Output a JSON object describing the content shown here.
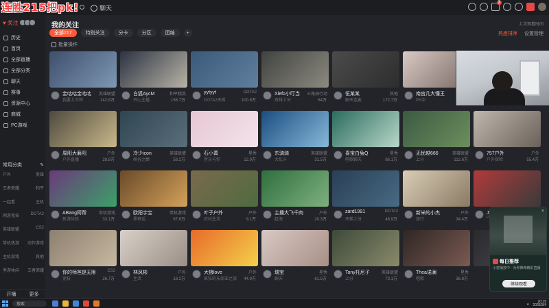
{
  "overlay_title": "连胜215把pk!",
  "topbar": {
    "chat_label": "聊天",
    "tool_icons": [
      "history-icon",
      "heart-icon",
      "message-icon",
      "notification-icon",
      "settings-icon",
      "gift-icon",
      "user-avatar"
    ],
    "badge_count": "7"
  },
  "sidebar": {
    "follow_label": "关注",
    "items": [
      {
        "label": "历史",
        "icon": "history-icon"
      },
      {
        "label": "首页",
        "icon": "home-icon"
      },
      {
        "label": "全部直播",
        "icon": "live-icon"
      },
      {
        "label": "全部分类",
        "icon": "category-icon"
      },
      {
        "label": "聊天",
        "icon": "chat-icon"
      },
      {
        "label": "赛事",
        "icon": "trophy-icon"
      },
      {
        "label": "资源中心",
        "icon": "resource-icon"
      },
      {
        "label": "商城",
        "icon": "shop-icon"
      },
      {
        "label": "PC游戏",
        "icon": "pc-game-icon"
      }
    ],
    "common_label": "常用分类",
    "sub_rows": [
      [
        "户外",
        "英雄"
      ],
      [
        "王者荣耀",
        "和平"
      ],
      [
        "一起看",
        "主机"
      ],
      [
        "网游竞技",
        "DOTA2"
      ],
      [
        "英雄联盟",
        "CS2"
      ],
      [
        "单机热游",
        "动作游戏"
      ],
      [
        "主机游戏",
        "其他"
      ],
      [
        "手游休闲",
        "王者荣耀"
      ]
    ],
    "bottom": [
      "开播",
      "更多"
    ]
  },
  "main": {
    "title": "我的关注",
    "hint": "上次观看时间",
    "filters": [
      "全部217",
      "特别关注",
      "分卡",
      "分区",
      "团编",
      "+"
    ],
    "right_actions": {
      "hot": "热度排序",
      "settings": "设置管理"
    },
    "batch_label": "批量操作"
  },
  "cards": [
    {
      "name": "金咕咕金咕咕",
      "cat": "英雄联盟",
      "sub": "我要上大师",
      "heat": "142.8万",
      "c1": "#3f4f6b",
      "c2": "#7d98b5"
    },
    {
      "name": "白狐AycM",
      "cat": "和平精英",
      "sub": "开心主播",
      "heat": "158.7万",
      "c1": "#2c3342",
      "c2": "#b9b3a6"
    },
    {
      "name": "yyfyyf",
      "cat": "DOTA2",
      "sub": "DOTA2天梯",
      "heat": "100.8万",
      "c1": "#3b5a7a",
      "c2": "#5f7f9f"
    },
    {
      "name": "Xlefo小叮当",
      "cat": "三角洲行动",
      "sub": "双排上分",
      "heat": "64万",
      "c1": "#40433f",
      "c2": "#8c8a80"
    },
    {
      "name": "伍某某",
      "cat": "其他",
      "sub": "聊天连麦",
      "heat": "172.7万",
      "c1": "#4b4b4b",
      "c2": "#2d2d2d"
    },
    {
      "name": "南宫几大懂王",
      "cat": "户外",
      "sub": "PK中",
      "heat": "29.1万",
      "c1": "#d8c9c4",
      "c2": "#7b6b66"
    },
    {
      "name": "",
      "cat": "",
      "sub": "",
      "heat": "",
      "c1": "#c8cdd2",
      "c2": "#8f9398"
    },
    {
      "name": "周阳大襄阳",
      "cat": "户外",
      "sub": "户外直播",
      "heat": "28.8万",
      "c1": "#4e4a3e",
      "c2": "#c9b88a"
    },
    {
      "name": "冷少icon",
      "cat": "英雄联盟",
      "sub": "峡谷之巅",
      "heat": "58.2万",
      "c1": "#2f4550",
      "c2": "#5a6f7c"
    },
    {
      "name": "石小菁",
      "cat": "星秀",
      "sub": "音乐与你",
      "heat": "12.9万",
      "c1": "#e6c6d3",
      "c2": "#f3e4ea"
    },
    {
      "name": "东骑骑",
      "cat": "英雄联盟",
      "sub": "大乱斗",
      "heat": "31.5万",
      "c1": "#1b4e80",
      "c2": "#87b8d9"
    },
    {
      "name": "喜宝白兔Q",
      "cat": "星秀",
      "sub": "唱歌聊天",
      "heat": "86.1万",
      "c1": "#2b6b5e",
      "c2": "#b9d8c9"
    },
    {
      "name": "无忧越666",
      "cat": "英雄联盟",
      "sub": "上分",
      "heat": "112.6万",
      "c1": "#3b5a42",
      "c2": "#6d8f5d"
    },
    {
      "name": "757户外",
      "cat": "户外",
      "sub": "户外探险",
      "heat": "55.4万",
      "c1": "#bfb7ad",
      "c2": "#6b615a"
    },
    {
      "name": "ABang阿帮",
      "cat": "单机游戏",
      "sub": "新游体验",
      "heat": "33.1万",
      "c1": "#6a3a7a",
      "c2": "#3ca06a"
    },
    {
      "name": "欧阳宇宝",
      "cat": "单机游戏",
      "sub": "黑神话",
      "heat": "67.6万",
      "c1": "#6b4a2a",
      "c2": "#d3a25a"
    },
    {
      "name": "叶子户外",
      "cat": "户外",
      "sub": "农村生活",
      "heat": "9.1万",
      "c1": "#7a6a4d",
      "c2": "#4f6b3f"
    },
    {
      "name": "主播大飞千肉",
      "cat": "户外",
      "sub": "赶海",
      "heat": "20.3万",
      "c1": "#2f6f3f",
      "c2": "#7fb07f"
    },
    {
      "name": "zard1991",
      "cat": "DOTA2",
      "sub": "天梯上分",
      "heat": "48.9万",
      "c1": "#2a3f55",
      "c2": "#476b83"
    },
    {
      "name": "新米的小杰",
      "cat": "户外",
      "sub": "旅行",
      "heat": "34.4万",
      "c1": "#d9cdb6",
      "c2": "#8a7a64"
    },
    {
      "name": "JT丶浩克大魔王",
      "cat": "星秀",
      "sub": "PK",
      "heat": "140.6万",
      "c1": "#b13a3a",
      "c2": "#3a3a3a"
    },
    {
      "name": "你的师爸是无限流",
      "cat": "CS2",
      "sub": "竞技",
      "heat": "26.7万",
      "c1": "#8c8070",
      "c2": "#c8b8a0"
    },
    {
      "name": "林风彬",
      "cat": "户外",
      "sub": "生活",
      "heat": "18.2万",
      "c1": "#d8d0c8",
      "c2": "#9a8f86"
    },
    {
      "name": "大狼love",
      "cat": "户外",
      "sub": "疯狂的东南亚之旅",
      "heat": "44.9万",
      "c1": "#e86a2a",
      "c2": "#f4d14a"
    },
    {
      "name": "瑞宝",
      "cat": "星秀",
      "sub": "聊天",
      "heat": "61.5万",
      "c1": "#d8c8c4",
      "c2": "#a88f86"
    },
    {
      "name": "Tony托尼子",
      "cat": "英雄联盟",
      "sub": "上分",
      "heat": "73.1万",
      "c1": "#3d4a3a",
      "c2": "#8a8a6a"
    },
    {
      "name": "Thea诺澜",
      "cat": "星秀",
      "sub": "唱歌",
      "heat": "36.8万",
      "c1": "#2e2624",
      "c2": "#7b5a52"
    },
    {
      "name": "",
      "cat": "",
      "sub": "",
      "heat": "",
      "c1": "#2a2a2e",
      "c2": "#4a4a50"
    }
  ],
  "popup": {
    "title": "每日推荐",
    "desc": "小窗播放中 · 为你推荐精彩直播",
    "button": "继续观看",
    "close": "×"
  },
  "taskbar": {
    "search": "搜索",
    "time": "20:19",
    "date": "2025/3/4"
  }
}
